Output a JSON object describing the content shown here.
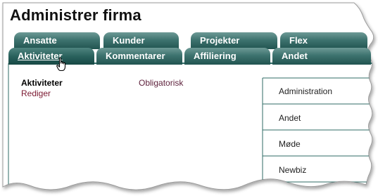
{
  "page": {
    "title": "Administrer firma"
  },
  "tabs": {
    "row1": [
      {
        "label": "Ansatte"
      },
      {
        "label": "Kunder"
      },
      {
        "label": "Projekter"
      },
      {
        "label": "Flex"
      }
    ],
    "row2": [
      {
        "label": "Aktiviteter",
        "active": true
      },
      {
        "label": "Kommentarer"
      },
      {
        "label": "Affiliering"
      },
      {
        "label": "Andet"
      }
    ]
  },
  "activities": {
    "header": "Aktiviteter",
    "edit_link": "Rediger",
    "column_label": "Obligatorisk"
  },
  "menu": {
    "items": [
      {
        "label": "Administration"
      },
      {
        "label": "Andet"
      },
      {
        "label": "Møde"
      },
      {
        "label": "Newbiz"
      }
    ]
  },
  "colors": {
    "tab_gradient_top": "#6e9a96",
    "tab_gradient_bottom": "#215450",
    "link_color": "#7a1830",
    "menu_divider": "#2f6b66"
  }
}
